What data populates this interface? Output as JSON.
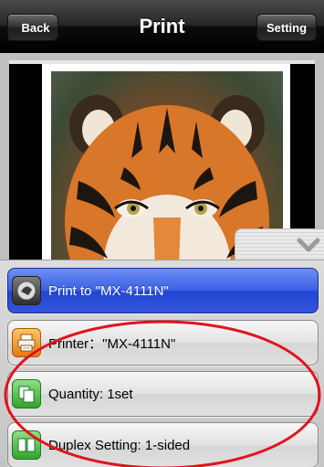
{
  "navbar": {
    "title": "Print",
    "back_label": "Back",
    "setting_label": "Setting"
  },
  "preview": {
    "image": "tiger-photo"
  },
  "menu": {
    "items": [
      {
        "label": "Print to \"MX-4111N\"",
        "icon": "print-icon",
        "selected": true
      },
      {
        "label": "Printer：\"MX-4111N\"",
        "icon": "printer-icon",
        "selected": false
      },
      {
        "label": "Quantity: 1set",
        "icon": "quantity-icon",
        "selected": false
      },
      {
        "label": "Duplex Setting: 1-sided",
        "icon": "duplex-icon",
        "selected": false
      }
    ]
  },
  "colors": {
    "navbar": "#1a1a1a",
    "selected_item": "#3355dd",
    "annotation": "#e2141b"
  }
}
